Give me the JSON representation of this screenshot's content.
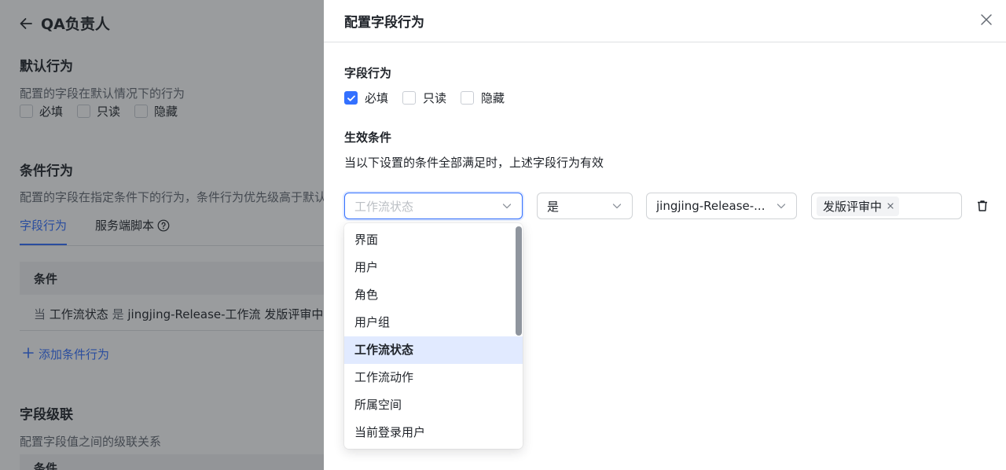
{
  "background": {
    "title": "QA负责人",
    "default_section": {
      "title": "默认行为",
      "desc": "配置的字段在默认情况下的行为",
      "options": [
        "必填",
        "只读",
        "隐藏"
      ]
    },
    "condition_section": {
      "title": "条件行为",
      "desc": "配置的字段在指定条件下的行为，条件行为优先级高于默认",
      "tabs": [
        "字段行为",
        "服务端脚本"
      ],
      "table_header": "条件",
      "row": {
        "when": "当",
        "field": "工作流状态",
        "op": "是",
        "workflow": "jingjing-Release-工作流",
        "state": "发版评审中"
      },
      "add_label": "添加条件行为"
    },
    "cascade_section": {
      "title": "字段级联",
      "desc": "配置字段值之间的级联关系",
      "table_header": "条件"
    }
  },
  "drawer": {
    "title": "配置字段行为",
    "behavior_label": "字段行为",
    "behaviors": [
      {
        "label": "必填",
        "checked": true
      },
      {
        "label": "只读",
        "checked": false
      },
      {
        "label": "隐藏",
        "checked": false
      }
    ],
    "condition_label": "生效条件",
    "condition_desc": "当以下设置的条件全部满足时，上述字段行为有效",
    "condition_row": {
      "field_placeholder": "工作流状态",
      "operator": "是",
      "workflow": "jingjing-Release-...",
      "tag": "发版评审中"
    }
  },
  "dropdown": {
    "items": [
      "界面",
      "用户",
      "角色",
      "用户组",
      "工作流状态",
      "工作流动作",
      "所属空间",
      "当前登录用户"
    ],
    "active": "工作流状态"
  },
  "colors": {
    "accent": "#3370ff",
    "mask": "rgba(31,35,41,0.45)"
  }
}
